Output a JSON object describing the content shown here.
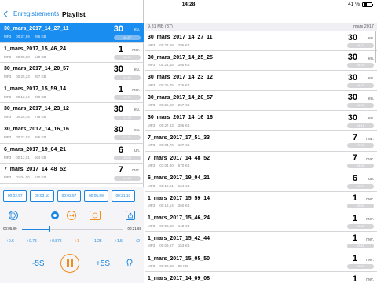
{
  "status": {
    "time": "14:28",
    "battery": "41 %"
  },
  "nav": {
    "back_label": "Enregistrements",
    "title": "Playlist"
  },
  "left_items": [
    {
      "name": "30_mars_2017_14_27_11",
      "fmt": "MP3",
      "dur": "00:27,69",
      "size": "286 KB",
      "day": "30",
      "dow": "jeu.",
      "time": "14:27",
      "selected": true
    },
    {
      "name": "1_mars_2017_15_46_24",
      "fmt": "MP3",
      "dur": "00:08,98",
      "size": "148 KB",
      "day": "1",
      "dow": "mer.",
      "time": "15:46"
    },
    {
      "name": "30_mars_2017_14_20_57",
      "fmt": "MP3",
      "dur": "00:25,23",
      "size": "267 KB",
      "day": "30",
      "dow": "jeu.",
      "time": "14:20"
    },
    {
      "name": "1_mars_2017_15_59_14",
      "fmt": "MP3",
      "dur": "00:12,14",
      "size": "260 KB",
      "day": "1",
      "dow": "mer.",
      "time": "15:59"
    },
    {
      "name": "30_mars_2017_14_23_12",
      "fmt": "MP3",
      "dur": "00:25,75",
      "size": "276 KB",
      "day": "30",
      "dow": "jeu.",
      "time": "14:23"
    },
    {
      "name": "30_mars_2017_14_16_16",
      "fmt": "MP3",
      "dur": "00:27,63",
      "size": "286 KB",
      "day": "30",
      "dow": "jeu.",
      "time": "14:16"
    },
    {
      "name": "6_mars_2017_19_04_21",
      "fmt": "MP3",
      "dur": "00:12,01",
      "size": "164 KB",
      "day": "6",
      "dow": "lun.",
      "time": "19:04"
    },
    {
      "name": "7_mars_2017_14_48_52",
      "fmt": "MP3",
      "dur": "01:04,00",
      "size": "570 KB",
      "day": "7",
      "dow": "mar.",
      "time": "14:48"
    }
  ],
  "player": {
    "times": [
      "00:02,57",
      "00:03,10",
      "00:03,57",
      "00:05,89",
      "00:21,10"
    ],
    "pos_label": "00:05,89",
    "dur_label": "00:21,69",
    "progress": 0.27,
    "speeds": [
      "+0.5",
      "+0.75",
      "+0.875",
      "+1",
      "+1.25",
      "+1.5",
      "+2"
    ],
    "active_speed_index": 3,
    "back_label": "-5S",
    "fwd_label": "+5S"
  },
  "right_header": {
    "left": "9.31 MB (37)",
    "right": "mars 2017"
  },
  "right_items": [
    {
      "name": "30_mars_2017_14_27_11",
      "fmt": "MP3",
      "dur": "00:27,69",
      "size": "286 KB",
      "day": "30",
      "dow": "jeu.",
      "time": "14:27"
    },
    {
      "name": "30_mars_2017_14_25_25",
      "fmt": "MP3",
      "dur": "00:24,45",
      "size": "265 KB",
      "day": "30",
      "dow": "jeu.",
      "time": "14:25"
    },
    {
      "name": "30_mars_2017_14_23_12",
      "fmt": "MP3",
      "dur": "00:25,75",
      "size": "276 KB",
      "day": "30",
      "dow": "jeu.",
      "time": "14:23"
    },
    {
      "name": "30_mars_2017_14_20_57",
      "fmt": "MP3",
      "dur": "00:25,23",
      "size": "267 KB",
      "day": "30",
      "dow": "jeu.",
      "time": "14:20"
    },
    {
      "name": "30_mars_2017_14_16_16",
      "fmt": "MP3",
      "dur": "00:27,63",
      "size": "286 KB",
      "day": "30",
      "dow": "jeu.",
      "time": "14:16"
    },
    {
      "name": "7_mars_2017_17_51_33",
      "fmt": "MP3",
      "dur": "00:04,70",
      "size": "107 KB",
      "day": "7",
      "dow": "mar.",
      "time": "17:51"
    },
    {
      "name": "7_mars_2017_14_48_52",
      "fmt": "MP3",
      "dur": "01:04,00",
      "size": "570 KB",
      "day": "7",
      "dow": "mar.",
      "time": "14:48"
    },
    {
      "name": "6_mars_2017_19_04_21",
      "fmt": "MP3",
      "dur": "00:12,01",
      "size": "164 KB",
      "day": "6",
      "dow": "lun.",
      "time": "19:04"
    },
    {
      "name": "1_mars_2017_15_59_14",
      "fmt": "MP3",
      "dur": "00:12,14",
      "size": "260 KB",
      "day": "1",
      "dow": "mer.",
      "time": "15:59"
    },
    {
      "name": "1_mars_2017_15_46_24",
      "fmt": "MP3",
      "dur": "00:08,98",
      "size": "148 KB",
      "day": "1",
      "dow": "mer.",
      "time": "15:46"
    },
    {
      "name": "1_mars_2017_15_42_44",
      "fmt": "MP3",
      "dur": "00:09,57",
      "size": "153 KB",
      "day": "1",
      "dow": "mer.",
      "time": "15:42"
    },
    {
      "name": "1_mars_2017_15_05_50",
      "fmt": "MP3",
      "dur": "00:02,03",
      "size": "88 KB",
      "day": "1",
      "dow": "mer.",
      "time": "15:05"
    },
    {
      "name": "1_mars_2017_14_09_08",
      "fmt": "MP3",
      "dur": "00:02,94",
      "size": "96 KB",
      "day": "1",
      "dow": "mer.",
      "time": "14:09"
    }
  ],
  "colors": {
    "accent": "#1a86e2",
    "selected": "#1a8ef0",
    "highlight": "#f28c1b"
  },
  "icons": [
    "chevron-left-icon",
    "tag-icon",
    "info-icon",
    "rewind-icon",
    "loop-icon",
    "share-icon",
    "pause-icon",
    "ear-icon"
  ]
}
